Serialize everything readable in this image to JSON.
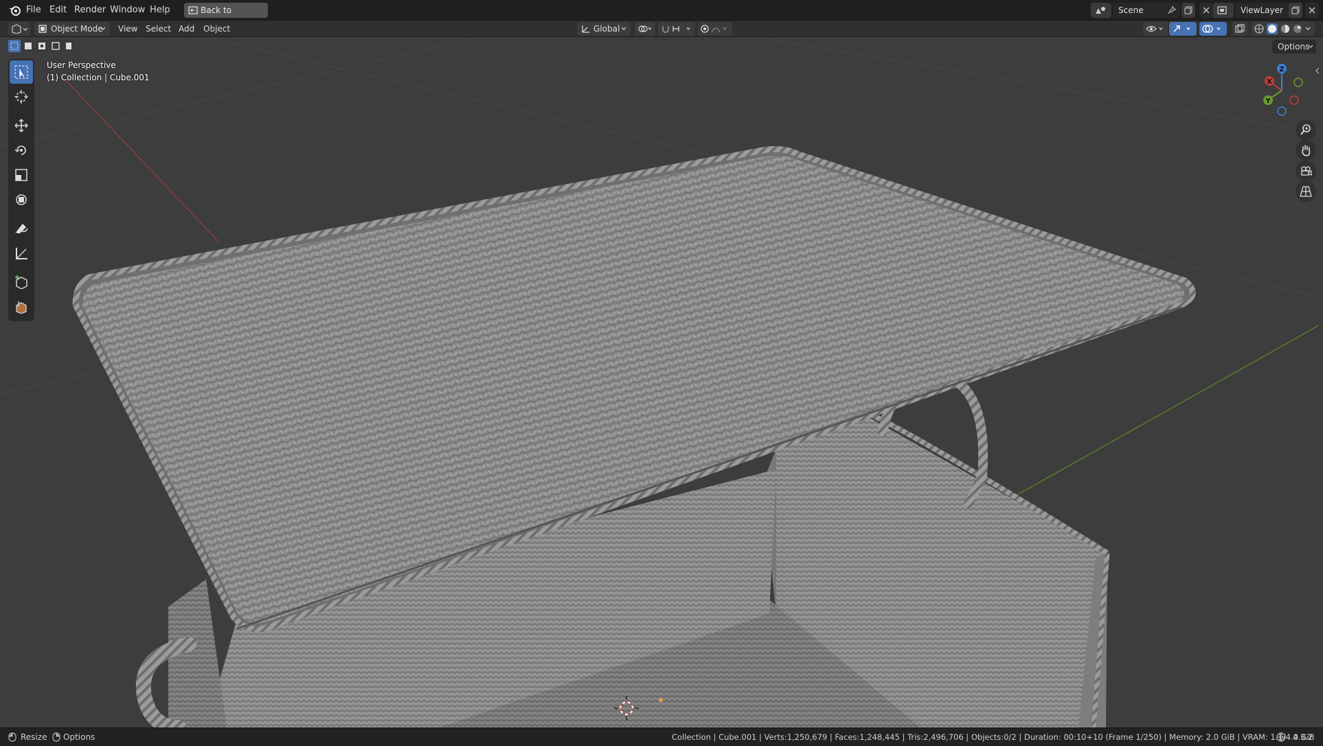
{
  "menu": {
    "items": [
      "File",
      "Edit",
      "Render",
      "Window",
      "Help"
    ],
    "back_button": "Back to Previous",
    "scene_label": "Scene",
    "view_layer_label": "ViewLayer"
  },
  "header": {
    "mode": "Object Mode",
    "view": "View",
    "select": "Select",
    "add": "Add",
    "object": "Object",
    "transform_orientation": "Global",
    "options": "Options"
  },
  "viewport": {
    "perspective_label": "User Perspective",
    "collection_label": "(1) Collection | Cube.001",
    "gizmo_axes": {
      "x": "X",
      "y": "Y",
      "z": "Z"
    },
    "colors": {
      "background": "#3d3d3d",
      "x_axis": "#c23b3b",
      "y_axis": "#6c9a2e",
      "z_axis": "#3f7fd8",
      "mesh": "#8e8e8e",
      "accent": "#4772b3"
    }
  },
  "toolbar": {
    "tools": [
      "select-box-icon",
      "cursor-icon",
      "move-icon",
      "rotate-icon",
      "scale-icon",
      "transform-icon",
      "annotate-icon",
      "measure-icon",
      "add-cube-icon",
      "add-primitive-icon"
    ]
  },
  "statusbar": {
    "left_resize": "Resize",
    "left_options": "Options",
    "stats": "Collection | Cube.001 | Verts:1,250,679 | Faces:1,248,445 | Tris:2,496,706 | Objects:0/2 | Duration: 00:10+10 (Frame 1/250) | Memory: 2.0 GiB | VRAM: 1.1/4.0 GiB",
    "version": "4.3.2"
  }
}
